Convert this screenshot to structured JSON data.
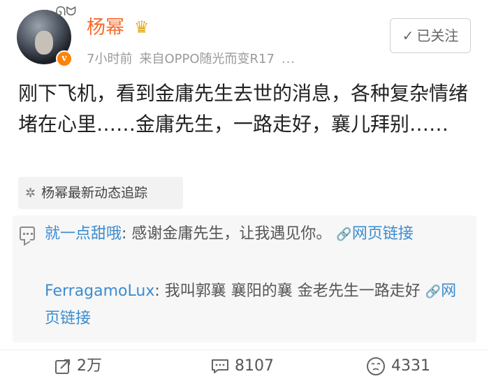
{
  "post": {
    "username": "杨幂",
    "verified_badge": "v",
    "time": "7小时前",
    "source": "来自OPPO随光而变R17",
    "more": "...",
    "follow_label": "已关注",
    "text": "刚下飞机，看到金庸先生去世的消息，各种复杂情绪堵在心里……金庸先生，一路走好，襄儿拜别……",
    "topic": "杨幂最新动态追踪"
  },
  "comments": [
    {
      "author": "就一点甜哦",
      "text": ": 感谢金庸先生，让我遇见你。 ",
      "link": "网页链接"
    },
    {
      "author": "FerragamoLux",
      "text": ": 我叫郭襄 襄阳的襄 金老先生一路走好 ",
      "link": "网页链接"
    }
  ],
  "actions": {
    "repost_count": "2万",
    "comment_count": "8107",
    "like_count": "4331"
  },
  "icons": {
    "avatar_deco": "cat-ears-icon",
    "crown": "crown-icon",
    "topic": "sparkle-icon",
    "comment": "comment-bubble-icon",
    "link": "link-icon",
    "repost": "repost-icon",
    "like": "like-icon"
  },
  "colors": {
    "username": "#f86a2c",
    "link": "#3c8ccf",
    "badge": "#ff8200",
    "crown": "#e2a81b"
  }
}
